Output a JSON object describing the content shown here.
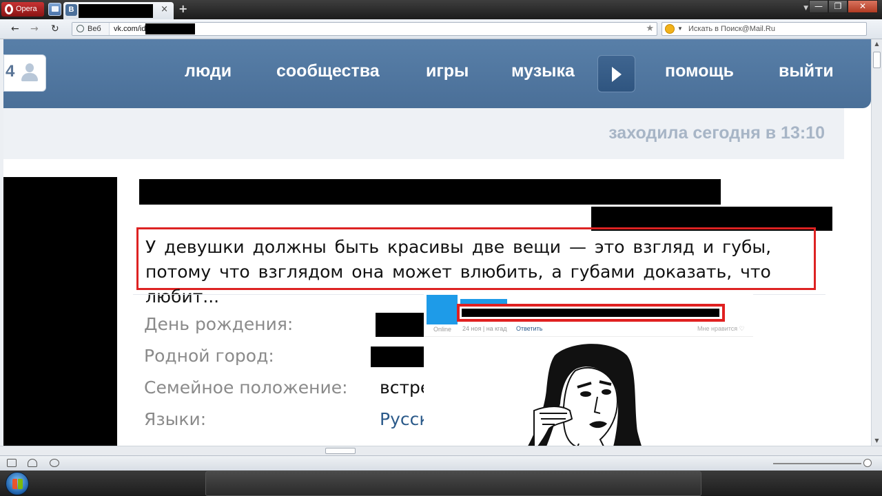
{
  "browser": {
    "menu_label": "Opera",
    "address_mode": "Веб",
    "url": "vk.com/id",
    "search_placeholder": "Искать в Поиск@Mail.Ru",
    "tab_close": "×",
    "new_tab": "+",
    "window_controls": [
      "—",
      "❐",
      "✕"
    ]
  },
  "vk": {
    "counter": "4",
    "menu": [
      "люди",
      "сообщества",
      "игры",
      "музыка",
      "помощь",
      "выйти"
    ],
    "last_seen": "заходила сегодня в 13:10",
    "status": "У девушки должны быть красивы две вещи — это взгляд и губы, потому что взглядом она может влюбить, а губами доказать, что любит...",
    "profile": {
      "birthday_label": "День рождения:",
      "hometown_label": "Родной город:",
      "relationship_label": "Семейное положение:",
      "relationship_value": "встре",
      "languages_label": "Языки:",
      "languages_value": "Русск"
    }
  },
  "overlay": {
    "meta_online": "Online",
    "meta_date": "24 ноя | на кгад",
    "reply": "Ответить",
    "likes": "Мне нравится ♡"
  },
  "colors": {
    "vk_header": "#587fa8",
    "highlight_border": "#dd2222",
    "link": "#2b5a8a"
  }
}
